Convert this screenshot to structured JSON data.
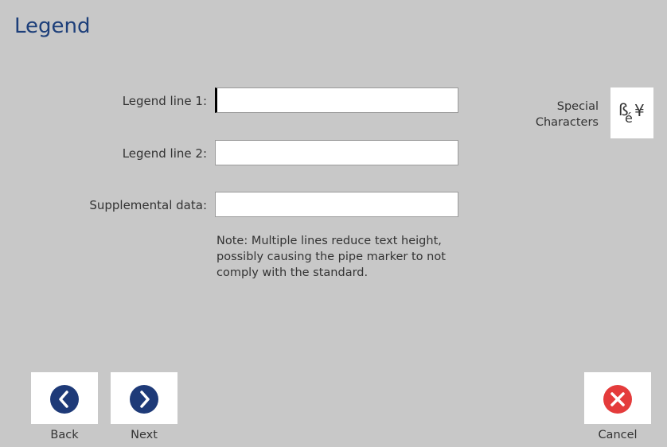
{
  "header": {
    "title": "Legend"
  },
  "form": {
    "line1": {
      "label": "Legend line 1:",
      "value": ""
    },
    "line2": {
      "label": "Legend line 2:",
      "value": ""
    },
    "supplemental": {
      "label": "Supplemental data:",
      "value": ""
    },
    "note": "Note: Multiple lines reduce text height, possibly causing the pipe marker to not comply with the standard."
  },
  "special": {
    "label_line1": "Special",
    "label_line2": "Characters",
    "icon": "special-characters-icon"
  },
  "footer": {
    "back_label": "Back",
    "next_label": "Next",
    "cancel_label": "Cancel"
  },
  "colors": {
    "background": "#c8c8c8",
    "title": "#1d3f7a",
    "nav_circle": "#1e3a78",
    "cancel_circle": "#e43b3b"
  }
}
